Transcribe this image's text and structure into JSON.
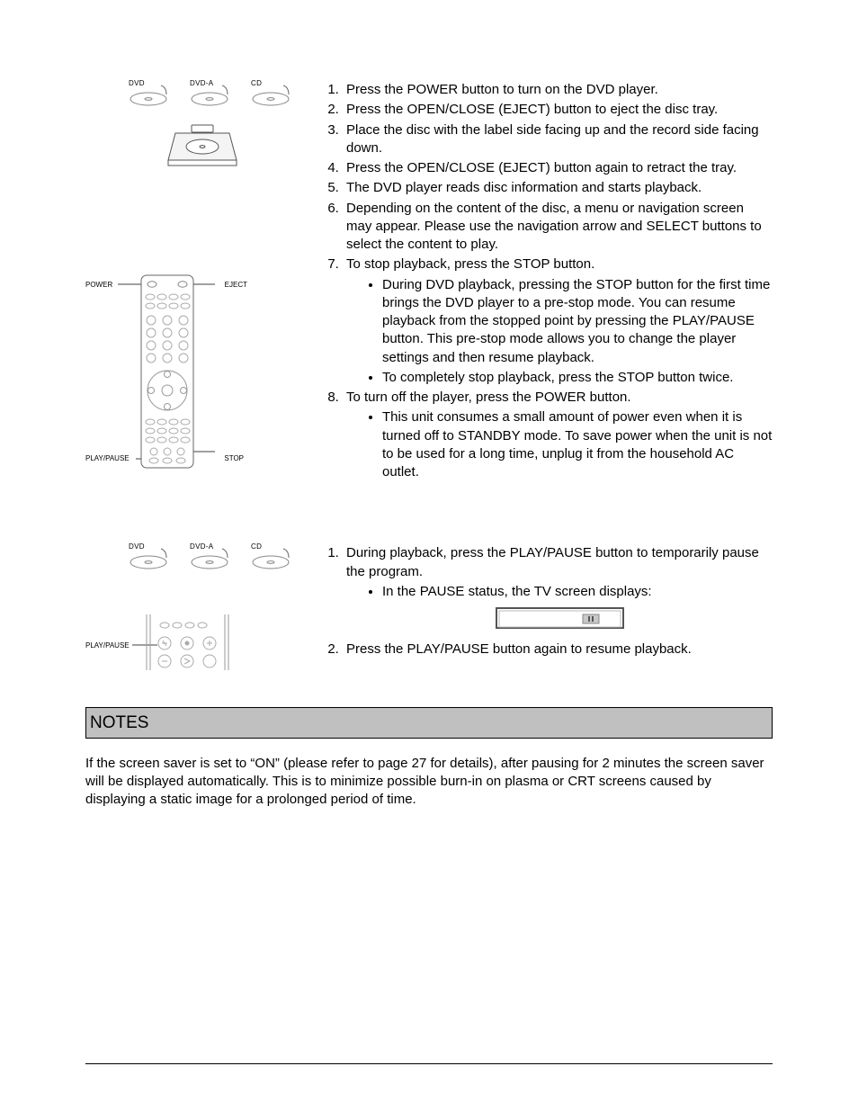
{
  "discs": {
    "dvd": "DVD",
    "dvda": "DVD-A",
    "cd": "CD"
  },
  "diagram": {
    "remote": {
      "power": "POWER",
      "eject": "EJECT",
      "playpause": "PLAY/PAUSE",
      "stop": "STOP"
    },
    "player": {
      "playpause": "PLAY/PAUSE"
    },
    "pause_icon": "II"
  },
  "steps1": {
    "1": "Press the POWER button to turn on the DVD player.",
    "2": "Press the OPEN/CLOSE (EJECT) button to eject the disc tray.",
    "3": "Place the disc with the label side facing up and the record side facing down.",
    "4": "Press the OPEN/CLOSE (EJECT) button again to retract the tray.",
    "5": "The DVD player reads disc information and starts playback.",
    "6": "Depending on the content of the disc, a menu or navigation screen may appear.  Please use the navigation arrow and SELECT buttons to select the content to play.",
    "7": "To stop playback, press the STOP button.",
    "7a": "During DVD playback, pressing the STOP button for the first time brings the DVD player to a pre-stop mode.  You can resume playback from the stopped point by pressing the PLAY/PAUSE button.  This pre-stop mode allows you to change the player settings and then resume playback.",
    "7b": "To completely stop playback, press the STOP button twice.",
    "8": "To turn off the player, press the POWER button.",
    "8a": "This unit consumes a small amount of power even when it is turned off to STANDBY mode.  To save power when the unit is not to be used for a long time, unplug it from the household AC outlet."
  },
  "steps2": {
    "1": "During playback, press the PLAY/PAUSE button to temporarily pause the program.",
    "1a": "In the PAUSE status, the TV screen displays:",
    "2": "Press the PLAY/PAUSE button again to resume playback."
  },
  "notes": {
    "header": "NOTES",
    "body": "If the screen saver is set to “ON” (please refer to page 27 for details), after pausing for 2 minutes the screen saver will be displayed automatically.  This is to minimize possible burn-in on plasma or CRT screens caused by displaying a static image for a prolonged period of time."
  }
}
